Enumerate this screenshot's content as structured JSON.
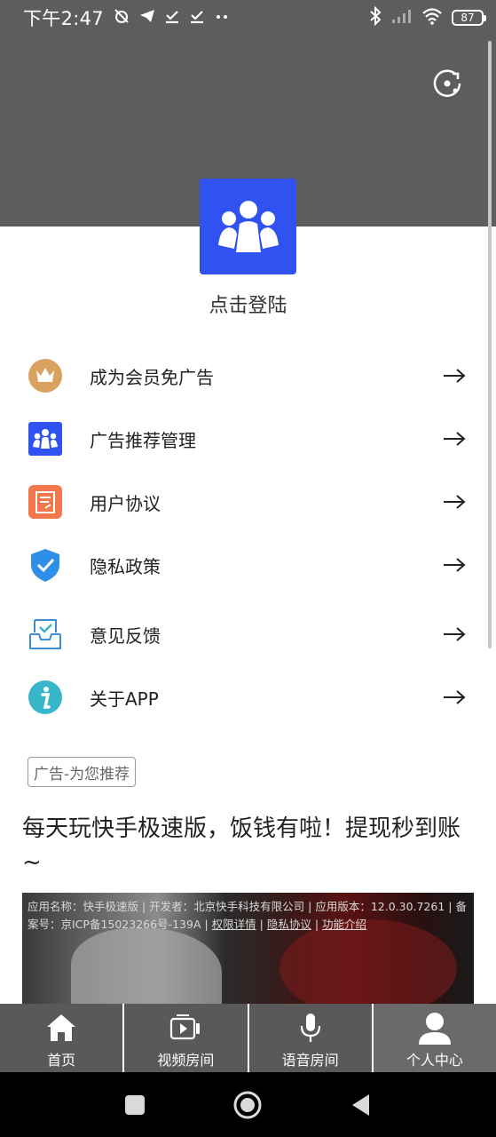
{
  "status_bar": {
    "time": "下午2:47",
    "battery": "87"
  },
  "profile": {
    "login_prompt": "点击登陆"
  },
  "menu": [
    {
      "label": "成为会员免广告",
      "icon": "crown-icon",
      "color": "#d9a25e"
    },
    {
      "label": "广告推荐管理",
      "icon": "people-icon",
      "color": "#2f52f1"
    },
    {
      "label": "用户协议",
      "icon": "document-icon",
      "color": "#f2784b"
    },
    {
      "label": "隐私政策",
      "icon": "shield-check-icon",
      "color": "#2e8fe8"
    },
    {
      "label": "意见反馈",
      "icon": "inbox-icon",
      "color": "#3a8fd8"
    },
    {
      "label": "关于APP",
      "icon": "info-icon",
      "color": "#38b6c9"
    }
  ],
  "ad": {
    "tag": "广告-为您推荐",
    "title": "每天玩快手极速版，饭钱有啦！提现秒到账~",
    "disclaimer_part1": "应用名称：快手极速版 | 开发者：北京快手科技有限公司 | 应用版本：12.0.30.7261 | 备案号：京ICP备15023266号-139A | ",
    "link_permissions": "权限详情",
    "sep": " | ",
    "link_privacy": "隐私协议",
    "link_intro": "功能介绍"
  },
  "bottom_nav": [
    {
      "label": "首页",
      "icon": "home-icon"
    },
    {
      "label": "视频房间",
      "icon": "video-play-icon"
    },
    {
      "label": "语音房间",
      "icon": "microphone-icon"
    },
    {
      "label": "个人中心",
      "icon": "person-icon"
    }
  ]
}
